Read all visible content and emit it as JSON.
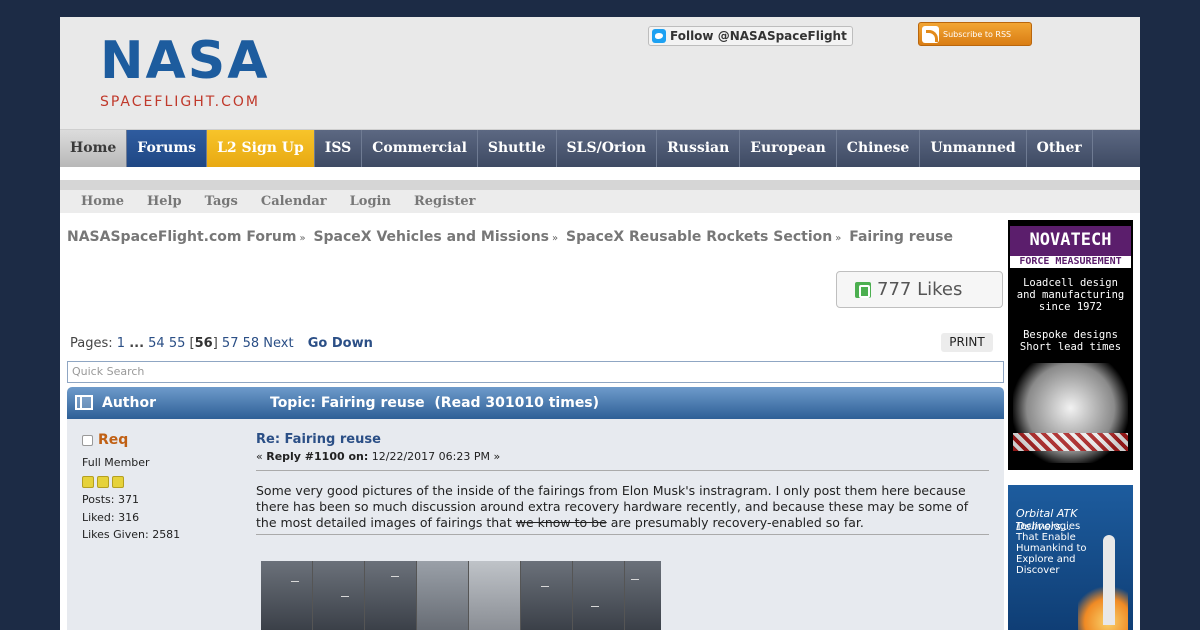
{
  "header": {
    "logo_nasa": "NASA",
    "logo_sub": "SPACEFLIGHT.COM",
    "follow_label": "Follow @NASASpaceFlight",
    "rss_label": "Subscribe to RSS"
  },
  "main_nav": [
    "Home",
    "Forums",
    "L2 Sign Up",
    "ISS",
    "Commercial",
    "Shuttle",
    "SLS/Orion",
    "Russian",
    "European",
    "Chinese",
    "Unmanned",
    "Other"
  ],
  "sub_nav": [
    "Home",
    "Help",
    "Tags",
    "Calendar",
    "Login",
    "Register"
  ],
  "breadcrumb": [
    "NASASpaceFlight.com Forum",
    "SpaceX Vehicles and Missions",
    "SpaceX Reusable Rockets Section",
    "Fairing reuse"
  ],
  "breadcrumb_sep": "»",
  "likes_label": "777 Likes",
  "pagination": {
    "label": "Pages:",
    "first": "1",
    "ellipsis": "...",
    "p54": "54",
    "p55": "55",
    "current": "56",
    "p57": "57",
    "p58": "58",
    "next": "Next",
    "go_down": "Go Down"
  },
  "print_label": "PRINT",
  "search": {
    "placeholder": "Quick Search"
  },
  "topic_bar": {
    "author": "Author",
    "topic": "Topic: Fairing reuse  (Read 301010 times)"
  },
  "post": {
    "author": "Req",
    "rank": "Full Member",
    "stars": 3,
    "posts": "Posts: 371",
    "liked": "Liked: 316",
    "likes_given": "Likes Given: 2581",
    "subject": "Re: Fairing reuse",
    "meta_prefix": "« ",
    "reply": "Reply #1100 on:",
    "date": " 12/22/2017 06:23 PM »",
    "text_before": "Some very good pictures of the inside of the fairings from Elon Musk's instragram.  I only post them here because there has been so much discussion around extra recovery hardware recently, and because these may be some of the most detailed images of fairings that ",
    "text_struck": "we know to be",
    "text_after": " are presumably recovery-enabled so far."
  },
  "ads": {
    "novatech_logo": "NOVATECH",
    "novatech_sub": "FORCE MEASUREMENT",
    "novatech_text1": "Loadcell design\nand manufacturing\nsince 1972",
    "novatech_text2": "Bespoke designs\nShort lead times",
    "orbital_heading": "Orbital ATK Delivers...",
    "orbital_text": "Technologies That Enable Humankind to Explore and Discover"
  }
}
